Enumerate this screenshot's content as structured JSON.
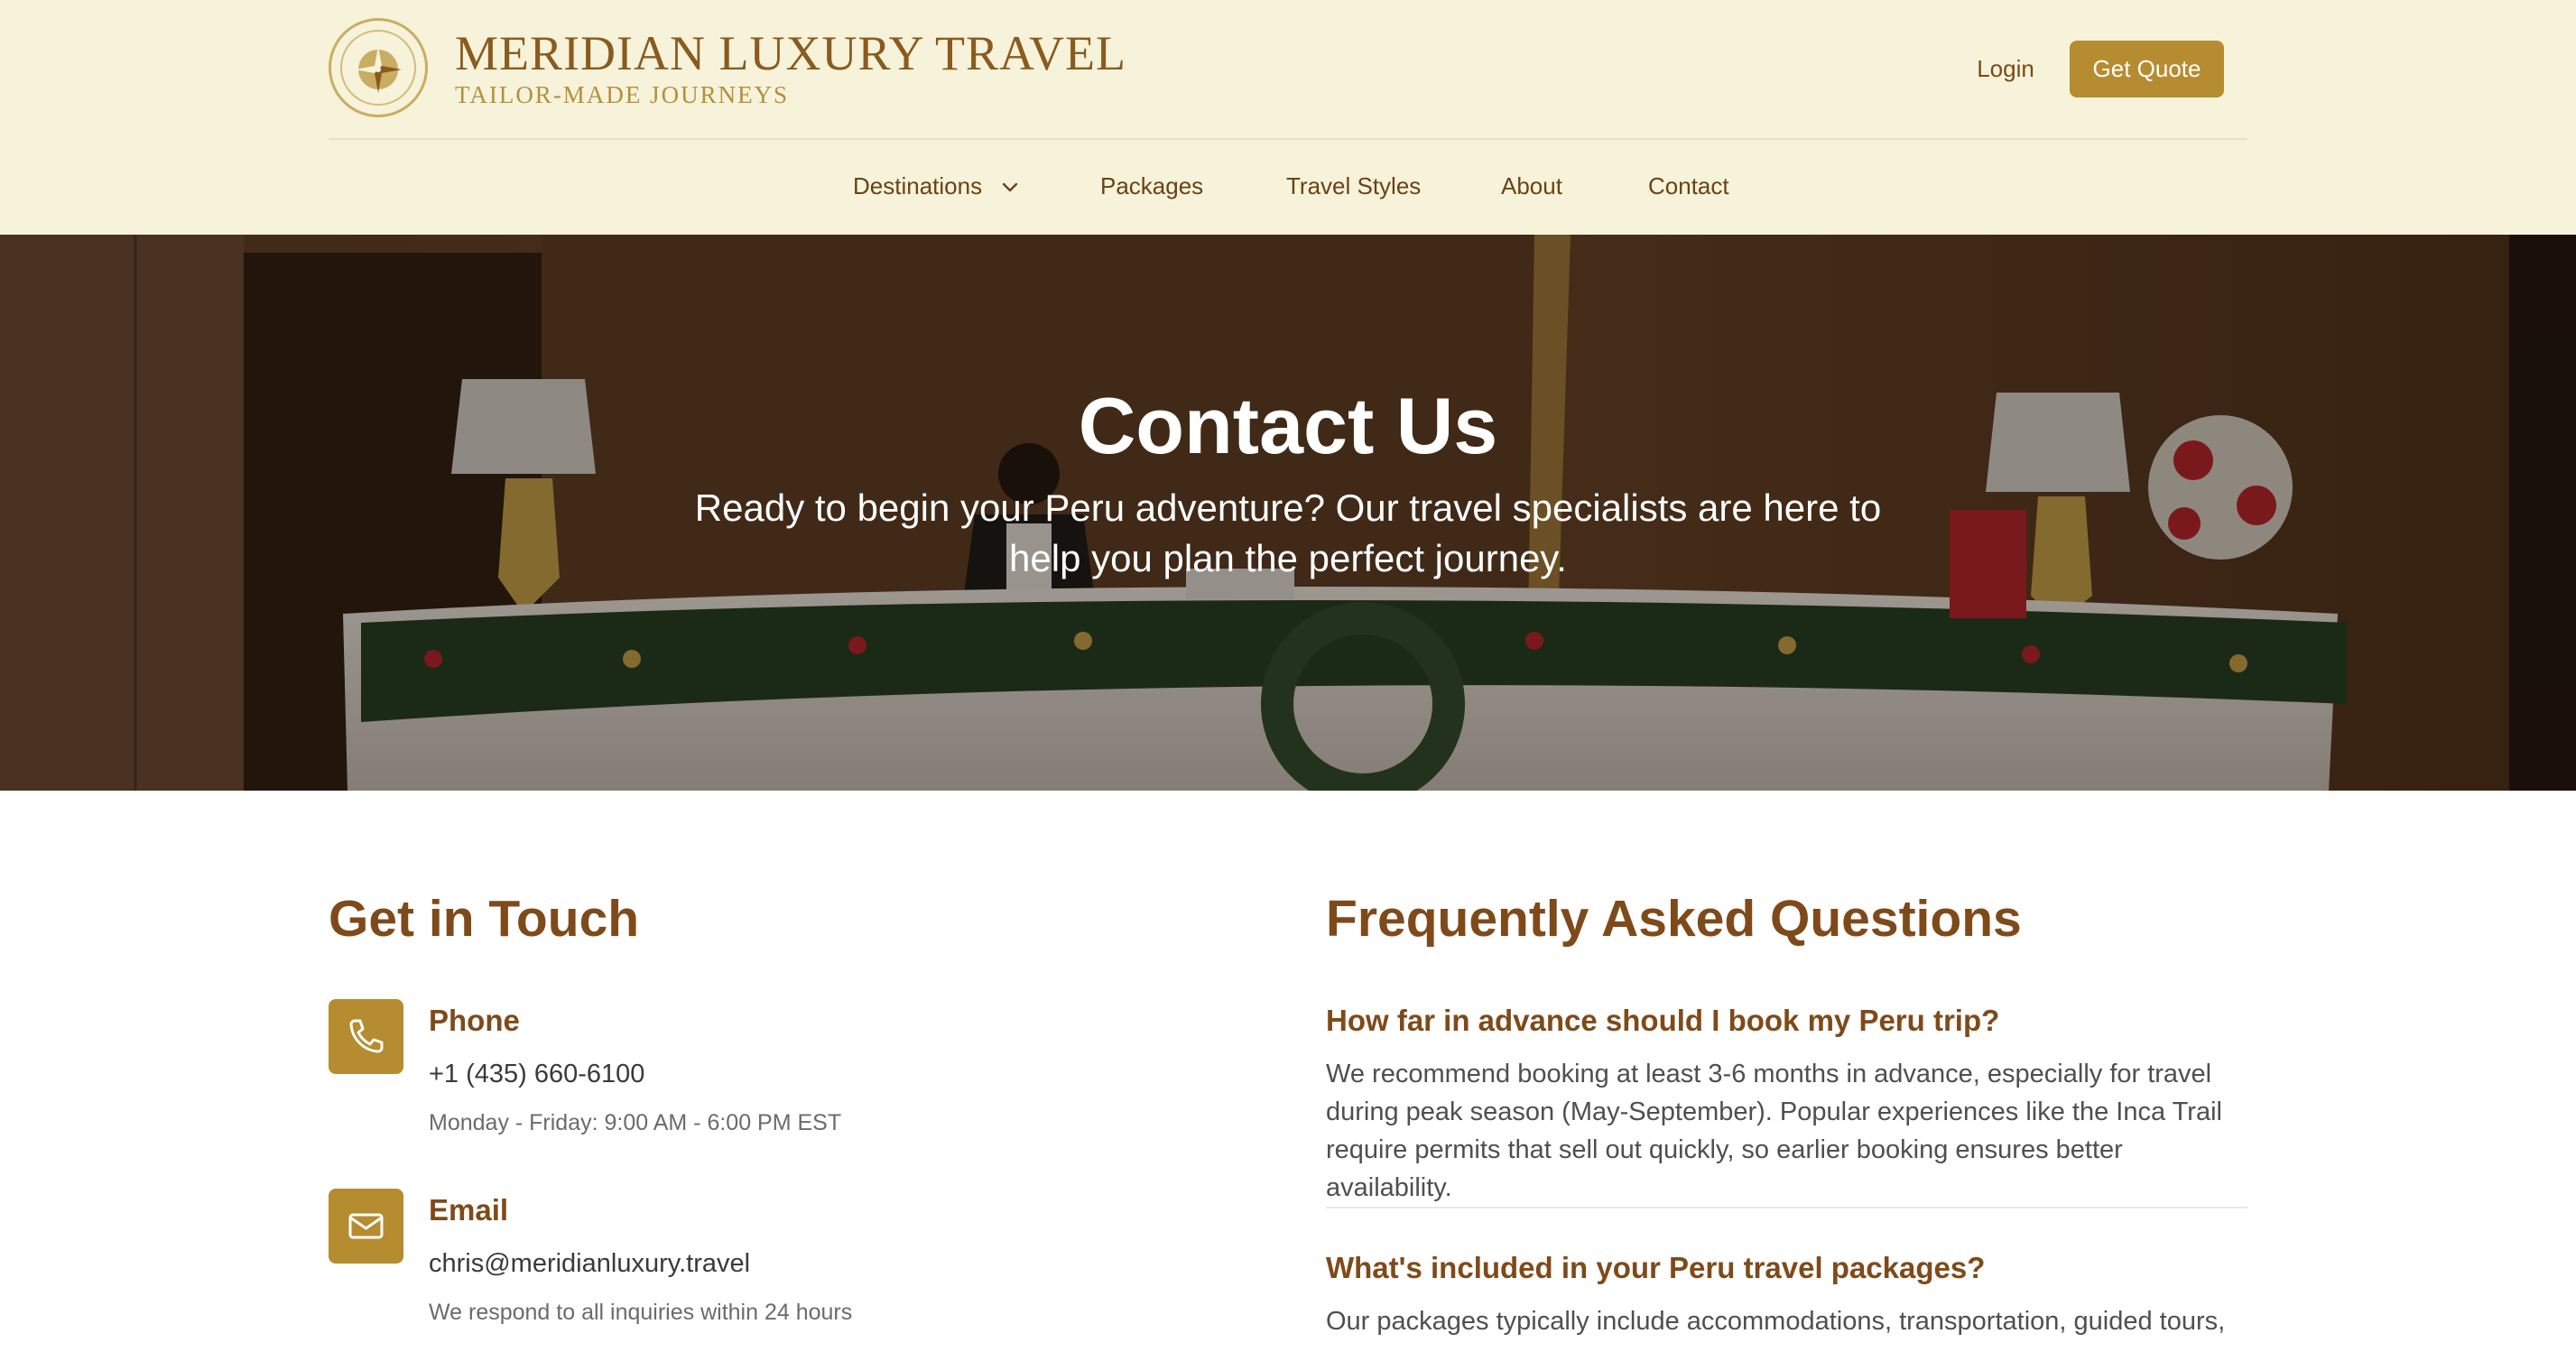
{
  "brand": {
    "name": "MERIDIAN LUXURY TRAVEL",
    "tagline": "TAILOR-MADE JOURNEYS"
  },
  "header": {
    "login_label": "Login",
    "quote_label": "Get Quote",
    "background": "#f6f3da",
    "accent": "#b58c2f"
  },
  "nav": {
    "items": [
      {
        "label": "Destinations",
        "has_dropdown": true
      },
      {
        "label": "Packages"
      },
      {
        "label": "Travel Styles"
      },
      {
        "label": "About"
      },
      {
        "label": "Contact"
      }
    ]
  },
  "hero": {
    "title": "Contact Us",
    "subtitle": "Ready to begin your Peru adventure? Our travel specialists are here to help you plan the perfect journey."
  },
  "contact": {
    "title": "Get in Touch",
    "items": [
      {
        "icon": "phone-icon",
        "label": "Phone",
        "value": "+1 (435) 660-6100",
        "note": "Monday - Friday: 9:00 AM - 6:00 PM EST"
      },
      {
        "icon": "mail-icon",
        "label": "Email",
        "value": "chris@meridianluxury.travel",
        "note": "We respond to all inquiries within 24 hours"
      }
    ]
  },
  "faq": {
    "title": "Frequently Asked Questions",
    "items": [
      {
        "question": "How far in advance should I book my Peru trip?",
        "answer": "We recommend booking at least 3-6 months in advance, especially for travel during peak season (May-September). Popular experiences like the Inca Trail require permits that sell out quickly, so earlier booking ensures better availability."
      },
      {
        "question": "What's included in your Peru travel packages?",
        "answer": "Our packages typically include accommodations, transportation, guided tours,"
      }
    ]
  },
  "colors": {
    "heading_brown": "#7f4a19",
    "gold": "#b58c2f"
  }
}
